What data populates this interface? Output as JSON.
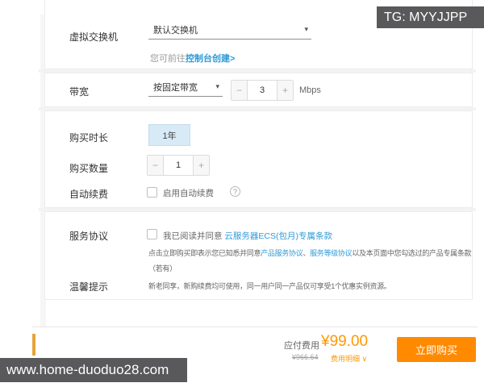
{
  "watermarks": {
    "top_right": "TG: MYYJJPP",
    "bottom_left": "www.home-duoduo28.com"
  },
  "icons": {
    "caret": "▾",
    "minus": "−",
    "plus": "+",
    "help": "?"
  },
  "colors": {
    "link_blue": "#2f9bd6",
    "button_orange": "#ff8a00",
    "price_orange": "#ff9800",
    "selected_duration_bg": "#d8eaf6",
    "watermark_bg": "#59595b"
  },
  "form": {
    "vswitch": {
      "label": "虚拟交换机",
      "value": "默认交换机",
      "hint_prefix": "您可前往",
      "hint_link": "控制台创建>"
    },
    "bandwidth": {
      "label": "带宽",
      "mode": "按固定带宽",
      "value": "3",
      "unit": "Mbps"
    },
    "duration": {
      "label": "购买时长",
      "selected": "1年"
    },
    "quantity": {
      "label": "购买数量",
      "value": "1"
    },
    "auto_renew": {
      "label": "自动续费",
      "checkbox_label": "启用自动续费"
    },
    "agreement": {
      "label": "服务协议",
      "checkbox_text": "我已阅读并同意",
      "terms_link": "云服务器ECS(包月)专属条款",
      "note_text": "点击立即购买即表示您已知悉并同意",
      "note_link1": "产品服务协议",
      "note_sep": "、",
      "note_link2": "服务等级协议",
      "note_tail": "以及本页面中您勾选过的产品专属条款",
      "note_line2": "（若有）"
    },
    "tips": {
      "label": "温馨提示",
      "text": "新老同享，新购续费均可使用，同一用户同一产品仅可享受1个优惠实例资源。"
    }
  },
  "footer": {
    "payable_label": "应付费用",
    "payable_amount": "¥99.00",
    "original_price": "¥966.64",
    "detail_link": "费用明细 ∨",
    "buy_button": "立即购买"
  }
}
